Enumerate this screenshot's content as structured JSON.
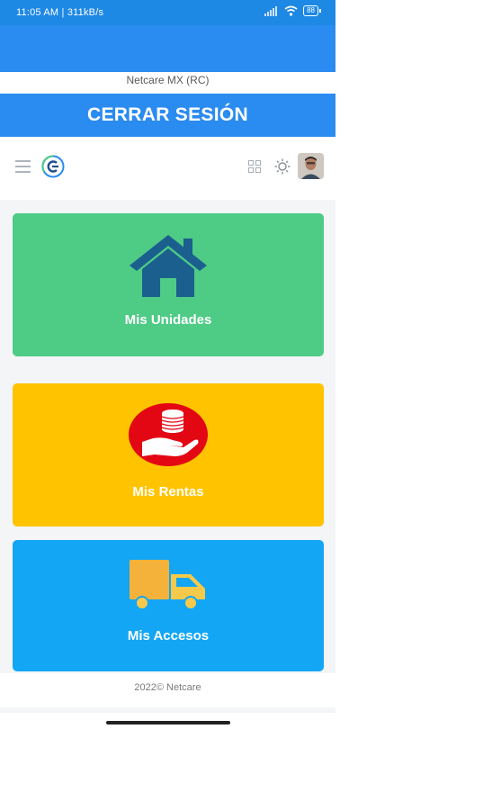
{
  "status_bar": {
    "time_speed": "11:05 AM | 311kB/s",
    "battery": "88"
  },
  "header": {
    "subtitle": "Netcare MX (RC)",
    "logout_label": "CERRAR SESIÓN"
  },
  "toolbar": {
    "icons": [
      "menu-icon",
      "logo-icon",
      "apps-grid-icon",
      "sun-icon",
      "avatar"
    ]
  },
  "cards": [
    {
      "label": "Mis Unidades",
      "color": "#4ecb85",
      "icon": "house-icon"
    },
    {
      "label": "Mis Rentas",
      "color": "#ffc300",
      "icon": "coins-hand-icon"
    },
    {
      "label": "Mis Accesos",
      "color": "#13a6f5",
      "icon": "truck-icon"
    }
  ],
  "footer": {
    "text": "2022©  Netcare"
  },
  "colors": {
    "primary": "#2a8bf0",
    "status_bar": "#1e88e5"
  }
}
